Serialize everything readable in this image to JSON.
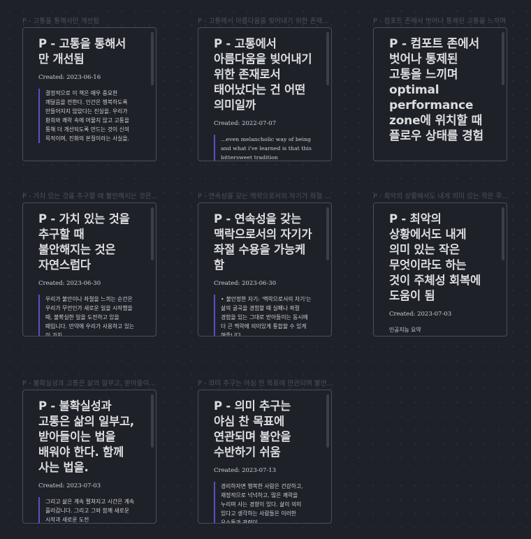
{
  "nodes": [
    {
      "label": "P - 고통을 통해서만 개선됨",
      "title": "P - 고통을 통해서 만 개선됨",
      "created": "Created: 2023-06-16",
      "body": "결정적으로 이 책은 매우 중요한 깨달음을 전한다. 인간은 행복하도록 만들어지지 않았다는 진실을. 우리가 환희와 쾌락 속에 머물지 않고 고통을 통해 더 개선되도록 만드는 것이 신의 목적이며, 진화의 본질이라는 사실을."
    },
    {
      "label": "P - 고통에서 아름다움을 빚어내기 위한 존재로서 태어났다는 건 어떤 의미일까",
      "title": "P - 고통에서 아름다움을 빚어내기 위한 존재로서 태어났다는 건 어떤 의미일까",
      "created": "Created: 2022-07-07",
      "body": "...even melancholic way of being and what i've learned is that this bittersweet tradition"
    },
    {
      "label": "P - 컴포트 존에서 벗어나 통제된 고통을 느끼며",
      "title": "P - 컴포트 존에서 벗어나 통제된 고통을 느끼며 optimal performance zone에 위치할 때 플로우 상태를 경험",
      "created": "",
      "body": ""
    },
    {
      "label": "P - 가치 있는 것을 추구할 때 불안해지는 것은 자연스럽다",
      "title": "P - 가치 있는 것을 추구할 때 불안해지는 것은 자연스럽다",
      "created": "Created: 2023-06-30",
      "body": "우리가 불안이나 좌절을 느끼는 순간은 우리가 무언인가 새로운 일을 시작했을 때, 불확실한 일을 도전하고 있을 때입니다. 만약에 우리가 사용하고 있는 이 가치"
    },
    {
      "label": "P - 연속성을 갖는 맥락으로서의 자기가 좌절 수용을 가능케 함",
      "title": "P - 연속성을 갖는 맥락으로서의 자기가 좌절 수용을 가능케 함",
      "created": "Created: 2023-06-30",
      "bullet": "•",
      "body": "불안정한 자기: '맥락으로서의 자기'는 삶의 굴곡을 경험할 때 실패나 좌절 경험을 있는 그대로 받아들이는 동시에 더 큰 맥락에 의미있게 통합할 수 있게 해줍니다"
    },
    {
      "label": "P - 최악의 상황에서도 내게 의미 있는 작은 무엇이라도",
      "title": "P - 최악의 상황에서도 내게 의미 있는 작은 무엇이라도 하는 것이 주체성 회복에 도움이 됨",
      "created": "Created: 2023-07-03",
      "body": "인공지능 요약"
    },
    {
      "label": "P - 불확실성과 고통은 삶의 일부고, 받아들이는 법을",
      "title": "P - 불확실성과 고통은 삶의 일부고, 받아들이는 법을 배워야 한다. 함께 사는 법을.",
      "created": "Created: 2023-07-03",
      "body": "그리고 삶은 계속 펼쳐지고 시간은 계속 흘러갑니다. 그리고 그와 함께 새로운 시작과 새로운 도전"
    },
    {
      "label": "P - 의미 추구는 야심 찬 목표에 연관되며 불안을 수반하기 쉬움",
      "title": "P - 의미 추구는 야심 찬 목표에 연관되며 불안을 수반하기 쉬움",
      "created": "Created: 2023-07-13",
      "body": "경리하자면 행복한 사람은 건강하고, 재정적으로 넉넉하고, 많은 쾌락을 누리며 사는 경향이 있다. 삶이 의미 있다고 생각하는 사람들은 이러한 요소들과 관련이"
    }
  ]
}
